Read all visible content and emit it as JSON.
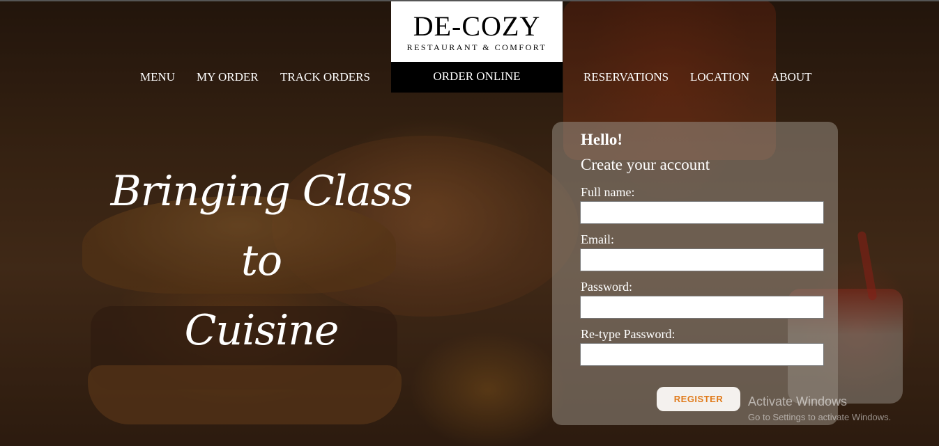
{
  "brand": {
    "title": "DE-COZY",
    "subtitle": "RESTAURANT & COMFORT"
  },
  "nav": {
    "menu": "MENU",
    "my_order": "MY ORDER",
    "track_orders": "TRACK ORDERS",
    "order_online": "ORDER ONLINE",
    "reservations": "RESERVATIONS",
    "location": "LOCATION",
    "about": "ABOUT"
  },
  "hero": {
    "line1": "Bringing Class",
    "line2": "to",
    "line3": "Cuisine"
  },
  "form": {
    "greeting": "Hello!",
    "heading": "Create your account",
    "full_name_label": "Full name:",
    "full_name_value": "",
    "email_label": "Email:",
    "email_value": "",
    "password_label": "Password:",
    "password_value": "",
    "retype_label": "Re-type Password:",
    "retype_value": "",
    "register_label": "REGISTER"
  },
  "watermark": {
    "title": "Activate Windows",
    "subtitle": "Go to Settings to activate Windows."
  },
  "colors": {
    "register_text": "#e07a1a",
    "order_online_bg": "#000000",
    "logo_bg": "#ffffff"
  }
}
